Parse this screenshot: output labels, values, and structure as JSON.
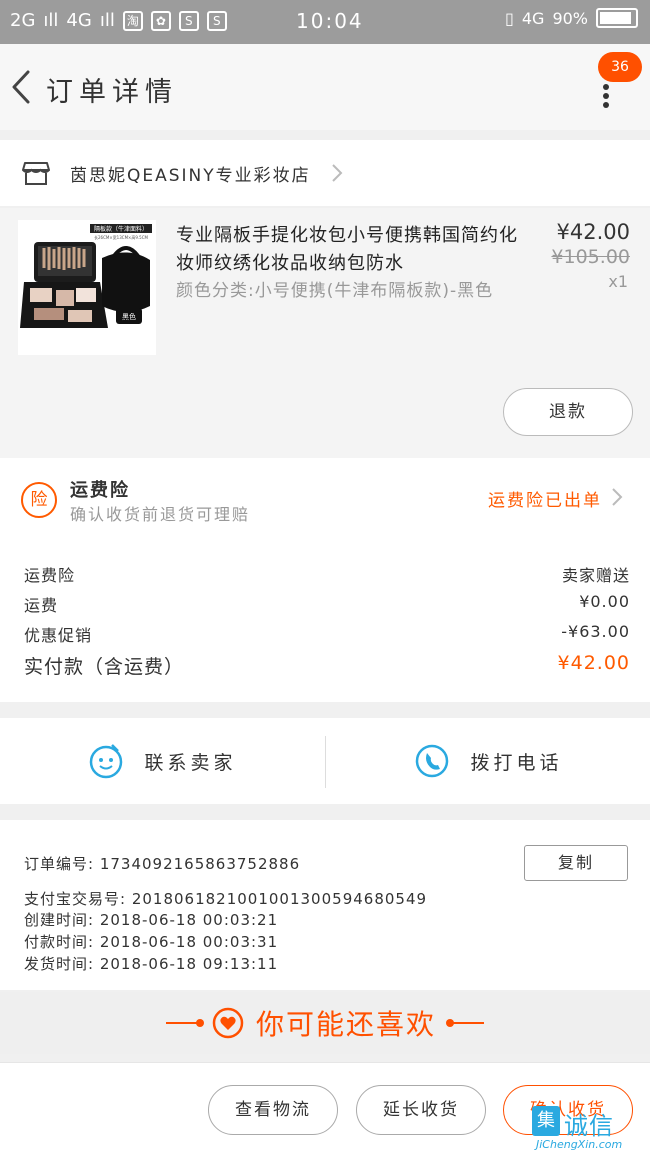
{
  "status_bar": {
    "signal_left": "2G",
    "signal_right": "4G",
    "mini_icons": [
      "淘",
      "✿",
      "S",
      "S"
    ],
    "time": "10:04",
    "network": "4G",
    "battery": "90%",
    "battery_level": 0.9
  },
  "header": {
    "title": "订单详情",
    "badge": "36"
  },
  "shop": {
    "name": "茵思妮QEASINY专业彩妆店"
  },
  "product": {
    "title": "专业隔板手提化妆包小号便携韩国简约化妆师纹绣化妆品收纳包防水",
    "sku": "颜色分类:小号便携(牛津布隔板款)-黑色",
    "price": "¥42.00",
    "original_price": "¥105.00",
    "quantity": "x1",
    "thumb_label": "隔板款（牛津面料）",
    "thumb_sub": "长26CM×宽13CM×高9.5CM",
    "thumb_color_tag": "黑色",
    "refund_label": "退款"
  },
  "insurance": {
    "icon_char": "险",
    "title": "运费险",
    "subtitle": "确认收货前退货可理赔",
    "status": "运费险已出单"
  },
  "fees": [
    {
      "label": "运费险",
      "value": "卖家赠送"
    },
    {
      "label": "运费",
      "value": "¥0.00"
    },
    {
      "label": "优惠促销",
      "value": "-¥63.00"
    }
  ],
  "total": {
    "label": "实付款（含运费）",
    "value": "¥42.00"
  },
  "contact": {
    "seller_label": "联系卖家",
    "call_label": "拨打电话"
  },
  "order_info": {
    "order_no": "订单编号:  1734092165863752886",
    "alipay_no": "支付宝交易号:  2018061821001001300594680549",
    "created": "创建时间:  2018-06-18  00:03:21",
    "paid": "付款时间:  2018-06-18  00:03:31",
    "shipped": "发货时间:  2018-06-18  09:13:11",
    "copy_label": "复制"
  },
  "recommend": {
    "title": "你可能还喜欢"
  },
  "bottom": {
    "logistics_label": "查看物流",
    "extend_label": "延长收货",
    "confirm_label": "确认收货"
  },
  "watermark": {
    "logo": "集",
    "cn": "诚信",
    "en": "JiChengXin.com"
  },
  "colors": {
    "accent": "#ff5000",
    "status_bar": "#9c9c9c",
    "link_blue": "#2aa9e0"
  }
}
